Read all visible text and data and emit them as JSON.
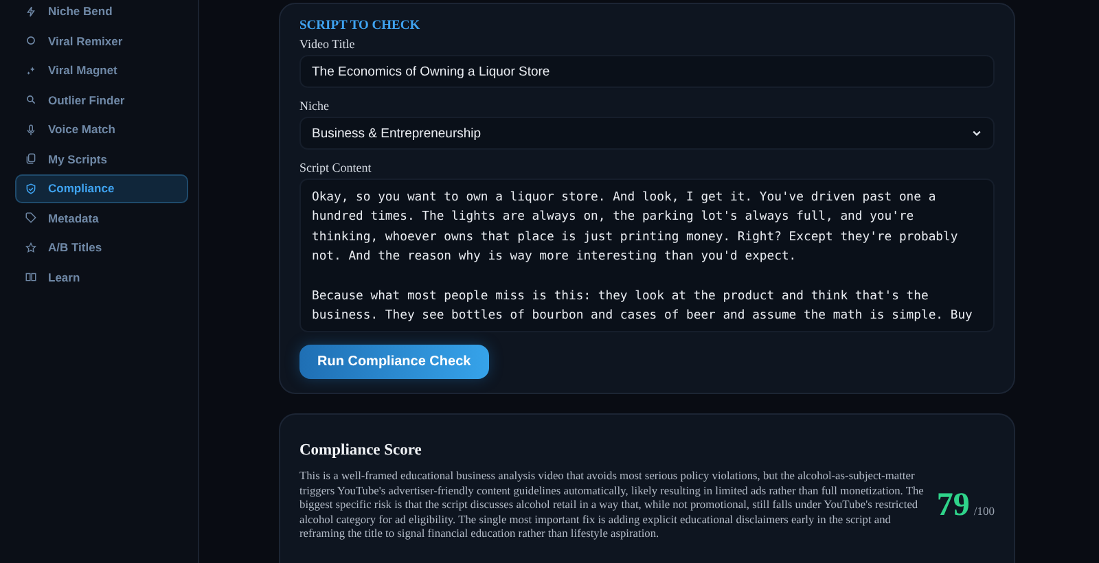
{
  "sidebar": {
    "items": [
      {
        "label": "Niche Bend",
        "selected": false
      },
      {
        "label": "Viral Remixer",
        "selected": false
      },
      {
        "label": "Viral Magnet",
        "selected": false
      },
      {
        "label": "Outlier Finder",
        "selected": false
      },
      {
        "label": "Voice Match",
        "selected": false
      },
      {
        "label": "My Scripts",
        "selected": false
      },
      {
        "label": "Compliance",
        "selected": true
      },
      {
        "label": "Metadata",
        "selected": false
      },
      {
        "label": "A/B Titles",
        "selected": false
      },
      {
        "label": "Learn",
        "selected": false
      }
    ]
  },
  "form": {
    "heading": "SCRIPT TO CHECK",
    "title_label": "Video Title",
    "title_value": "The Economics of Owning a Liquor Store",
    "niche_label": "Niche",
    "niche_value": "Business & Entrepreneurship",
    "script_label": "Script Content",
    "script_value": "Okay, so you want to own a liquor store. And look, I get it. You've driven past one a hundred times. The lights are always on, the parking lot's always full, and you're thinking, whoever owns that place is just printing money. Right? Except they're probably not. And the reason why is way more interesting than you'd expect.\n\nBecause what most people miss is this: they look at the product and think that's the business. They see bottles of bourbon and cases of beer and assume the math is simple. Buy",
    "button": "Run Compliance Check"
  },
  "result": {
    "heading": "Compliance Score",
    "summary": "This is a well-framed educational business analysis video that avoids most serious policy violations, but the alcohol-as-subject-matter triggers YouTube's advertiser-friendly content guidelines automatically, likely resulting in limited ads rather than full monetization. The biggest specific risk is that the script discusses alcohol retail in a way that, while not promotional, still falls under YouTube's restricted alcohol category for ad eligibility. The single most important fix is adding explicit educational disclaimers early in the script and reframing the title to signal financial education rather than lifestyle aspiration.",
    "score": "79",
    "out_of": "/100"
  }
}
